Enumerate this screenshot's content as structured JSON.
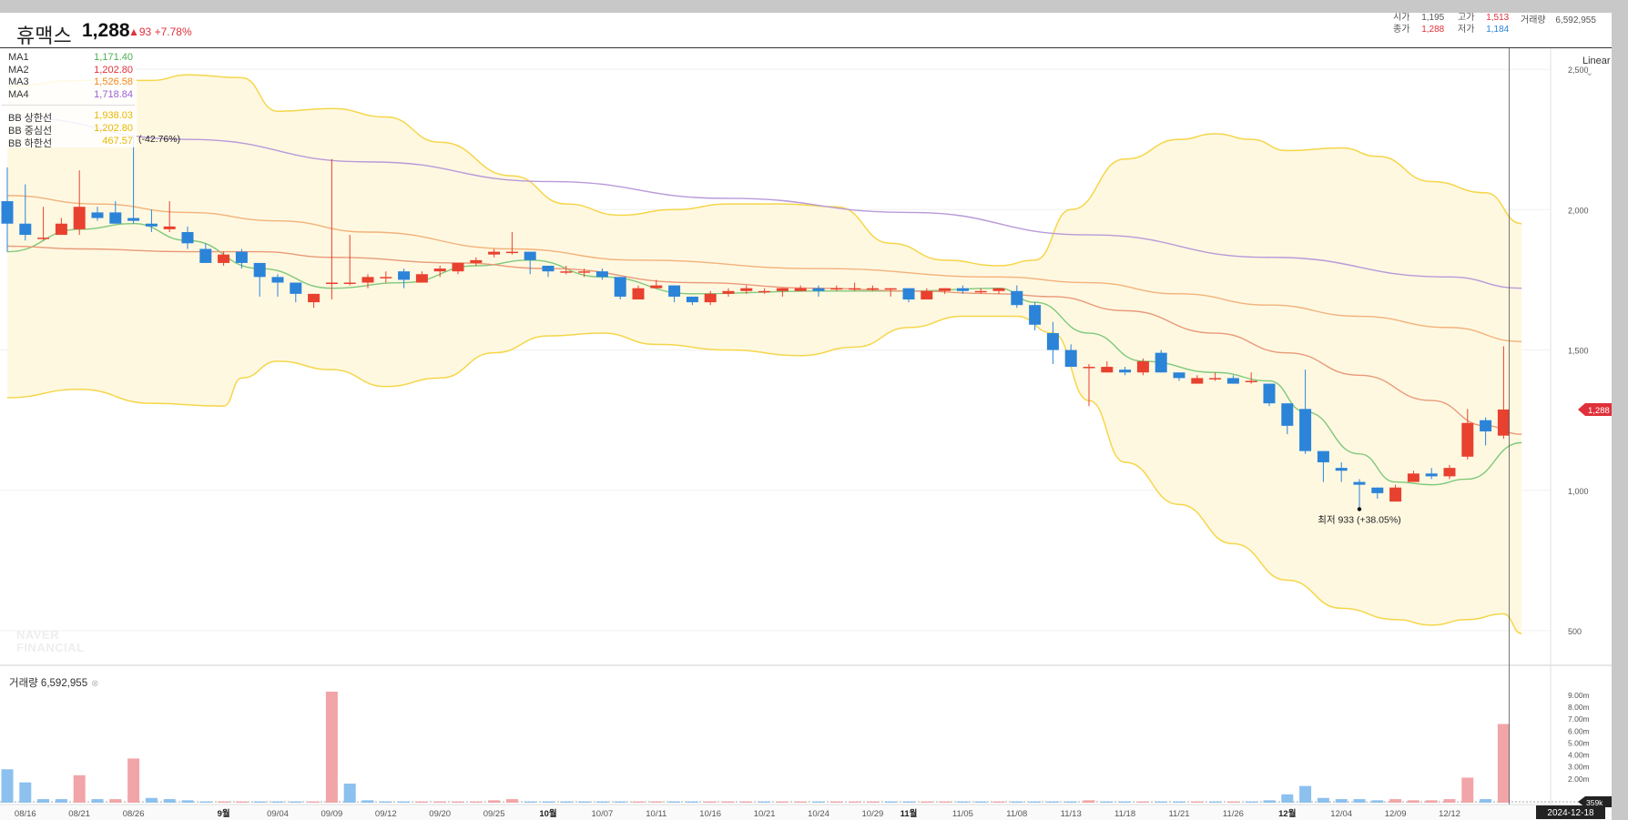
{
  "header": {
    "stock_name": "휴맥스",
    "price": "1,288",
    "change": "▲93",
    "change_pct": "+7.78%",
    "open_label": "시가",
    "open_value": "1,195",
    "high_label": "고가",
    "high_value": "1,513",
    "close_label": "종가",
    "close_value": "1,288",
    "low_label": "저가",
    "low_value": "1,184",
    "volume_label": "거래량",
    "volume_value": "6,592,955"
  },
  "legend": {
    "ma": [
      {
        "name": "MA1",
        "value": "1,171.40",
        "color": "#4caf50"
      },
      {
        "name": "MA2",
        "value": "1,202.80",
        "color": "#e0303a"
      },
      {
        "name": "MA3",
        "value": "1,526.58",
        "color": "#f08a24"
      },
      {
        "name": "MA4",
        "value": "1,718.84",
        "color": "#9c5fd1"
      }
    ],
    "bb": [
      {
        "name": "BB 상한선",
        "value": "1,938.03",
        "color": "#e8b800"
      },
      {
        "name": "BB 중심선",
        "value": "1,202.80",
        "color": "#e8b800"
      },
      {
        "name": "BB 하한선",
        "value": "467.57",
        "color": "#e8b800"
      }
    ]
  },
  "scale_mode": "Linear",
  "volume_title": "거래량 6,592,955",
  "watermark": [
    "NAVER",
    "FINANCIAL"
  ],
  "annotations": {
    "high_note": "(-42.76%)",
    "low_note": "최저 933 (+38.05%)",
    "current_price_tag": "1,288",
    "current_volume_tag": "359k",
    "current_date_tag": "2024-12-18"
  },
  "colors": {
    "up": "#e8412f",
    "down": "#2b84d8",
    "bb_fill": "#fff8e1",
    "bb_line": "#f5d64a",
    "vol_up": "#f1a5a8",
    "vol_down": "#8cc0ee"
  },
  "chart_data": {
    "type": "candlestick",
    "price_axis": {
      "ticks": [
        500,
        1000,
        1500,
        2000,
        2500
      ],
      "tick_labels": [
        "500",
        "1,000",
        "1,500",
        "2,000",
        "2,500"
      ],
      "scale": "linear"
    },
    "volume_axis": {
      "ticks": [
        2,
        3,
        4,
        5,
        6,
        7,
        8,
        9
      ],
      "tick_labels": [
        "2.00m",
        "3.00m",
        "4.00m",
        "5.00m",
        "6.00m",
        "7.00m",
        "8.00m",
        "9.00m"
      ],
      "unit": "millions"
    },
    "x_labels": [
      "08/16",
      "08/21",
      "08/26",
      "9월",
      "09/04",
      "09/09",
      "09/12",
      "09/20",
      "09/25",
      "10월",
      "10/07",
      "10/11",
      "10/16",
      "10/21",
      "10/24",
      "10/29",
      "11월",
      "11/05",
      "11/08",
      "11/13",
      "11/18",
      "11/21",
      "11/26",
      "12월",
      "12/04",
      "12/09",
      "12/12",
      "2024-12-18"
    ],
    "label_slots": [
      1,
      4,
      7,
      12,
      15,
      18,
      21,
      24,
      27,
      30,
      33,
      36,
      39,
      42,
      45,
      48,
      50,
      53,
      56,
      59,
      62,
      65,
      68,
      71,
      74,
      77,
      80,
      84
    ],
    "candles": [
      [
        2030,
        1950,
        2150,
        1850
      ],
      [
        1950,
        1910,
        2090,
        1890
      ],
      [
        1900,
        1900,
        2010,
        1890
      ],
      [
        1910,
        1950,
        1970,
        1910
      ],
      [
        1930,
        2010,
        2140,
        1910
      ],
      [
        1990,
        1970,
        2010,
        1960
      ],
      [
        1990,
        1950,
        2030,
        1950
      ],
      [
        1970,
        1960,
        2260,
        1950
      ],
      [
        1950,
        1940,
        2000,
        1920
      ],
      [
        1930,
        1940,
        2030,
        1920
      ],
      [
        1920,
        1880,
        1940,
        1860
      ],
      [
        1860,
        1810,
        1880,
        1810
      ],
      [
        1810,
        1840,
        1850,
        1800
      ],
      [
        1850,
        1810,
        1860,
        1790
      ],
      [
        1810,
        1760,
        1810,
        1690
      ],
      [
        1760,
        1740,
        1770,
        1690
      ],
      [
        1740,
        1700,
        1740,
        1670
      ],
      [
        1670,
        1700,
        1700,
        1650
      ],
      [
        1740,
        1740,
        2180,
        1680
      ],
      [
        1740,
        1740,
        1910,
        1730
      ],
      [
        1740,
        1760,
        1770,
        1720
      ],
      [
        1760,
        1760,
        1780,
        1740
      ],
      [
        1780,
        1750,
        1790,
        1720
      ],
      [
        1740,
        1770,
        1780,
        1740
      ],
      [
        1780,
        1790,
        1800,
        1760
      ],
      [
        1780,
        1810,
        1810,
        1770
      ],
      [
        1810,
        1820,
        1830,
        1800
      ],
      [
        1840,
        1850,
        1860,
        1830
      ],
      [
        1850,
        1850,
        1920,
        1840
      ],
      [
        1850,
        1820,
        1850,
        1770
      ],
      [
        1800,
        1780,
        1800,
        1760
      ],
      [
        1780,
        1780,
        1800,
        1770
      ],
      [
        1780,
        1780,
        1790,
        1760
      ],
      [
        1780,
        1760,
        1790,
        1750
      ],
      [
        1760,
        1690,
        1760,
        1680
      ],
      [
        1680,
        1720,
        1730,
        1680
      ],
      [
        1720,
        1730,
        1750,
        1720
      ],
      [
        1730,
        1690,
        1730,
        1670
      ],
      [
        1690,
        1670,
        1690,
        1660
      ],
      [
        1670,
        1700,
        1710,
        1660
      ],
      [
        1700,
        1710,
        1720,
        1690
      ],
      [
        1710,
        1720,
        1730,
        1700
      ],
      [
        1710,
        1710,
        1720,
        1700
      ],
      [
        1710,
        1720,
        1720,
        1690
      ],
      [
        1710,
        1720,
        1730,
        1710
      ],
      [
        1720,
        1710,
        1730,
        1690
      ],
      [
        1720,
        1720,
        1730,
        1710
      ],
      [
        1720,
        1720,
        1740,
        1710
      ],
      [
        1720,
        1720,
        1730,
        1710
      ],
      [
        1720,
        1720,
        1720,
        1690
      ],
      [
        1720,
        1680,
        1720,
        1670
      ],
      [
        1680,
        1710,
        1720,
        1680
      ],
      [
        1710,
        1720,
        1720,
        1700
      ],
      [
        1720,
        1710,
        1730,
        1700
      ],
      [
        1710,
        1710,
        1720,
        1700
      ],
      [
        1710,
        1720,
        1720,
        1700
      ],
      [
        1710,
        1660,
        1730,
        1650
      ],
      [
        1660,
        1590,
        1670,
        1570
      ],
      [
        1560,
        1500,
        1600,
        1450
      ],
      [
        1500,
        1440,
        1520,
        1440
      ],
      [
        1440,
        1440,
        1450,
        1300
      ],
      [
        1420,
        1440,
        1460,
        1420
      ],
      [
        1430,
        1420,
        1440,
        1410
      ],
      [
        1420,
        1460,
        1470,
        1410
      ],
      [
        1490,
        1420,
        1500,
        1420
      ],
      [
        1420,
        1400,
        1420,
        1390
      ],
      [
        1380,
        1400,
        1410,
        1380
      ],
      [
        1400,
        1400,
        1420,
        1390
      ],
      [
        1400,
        1380,
        1410,
        1380
      ],
      [
        1390,
        1390,
        1420,
        1380
      ],
      [
        1380,
        1310,
        1380,
        1300
      ],
      [
        1310,
        1230,
        1310,
        1200
      ],
      [
        1290,
        1140,
        1430,
        1130
      ],
      [
        1140,
        1100,
        1140,
        1030
      ],
      [
        1080,
        1070,
        1100,
        1030
      ],
      [
        1030,
        1020,
        1040,
        933
      ],
      [
        1010,
        990,
        1010,
        970
      ],
      [
        960,
        1010,
        1020,
        960
      ],
      [
        1030,
        1060,
        1070,
        1030
      ],
      [
        1060,
        1050,
        1080,
        1040
      ],
      [
        1050,
        1080,
        1090,
        1040
      ],
      [
        1120,
        1240,
        1290,
        1110
      ],
      [
        1250,
        1210,
        1260,
        1160
      ],
      [
        1195,
        1288,
        1513,
        1184
      ]
    ],
    "volume_m": [
      [
        2.8,
        0
      ],
      [
        1.7,
        0
      ],
      [
        0.3,
        0
      ],
      [
        0.3,
        0
      ],
      [
        2.3,
        1
      ],
      [
        0.3,
        0
      ],
      [
        0.3,
        1
      ],
      [
        3.7,
        1
      ],
      [
        0.4,
        0
      ],
      [
        0.3,
        0
      ],
      [
        0.2,
        0
      ],
      [
        0.1,
        0
      ],
      [
        0.1,
        1
      ],
      [
        0.1,
        1
      ],
      [
        0.1,
        0
      ],
      [
        0.1,
        0
      ],
      [
        0.1,
        0
      ],
      [
        0.1,
        1
      ],
      [
        9.3,
        1
      ],
      [
        1.6,
        0
      ],
      [
        0.2,
        0
      ],
      [
        0.1,
        0
      ],
      [
        0.1,
        0
      ],
      [
        0.1,
        1
      ],
      [
        0.1,
        1
      ],
      [
        0.1,
        1
      ],
      [
        0.1,
        1
      ],
      [
        0.2,
        1
      ],
      [
        0.3,
        1
      ],
      [
        0.1,
        0
      ],
      [
        0.1,
        0
      ],
      [
        0.1,
        0
      ],
      [
        0.1,
        0
      ],
      [
        0.1,
        0
      ],
      [
        0.1,
        0
      ],
      [
        0.1,
        1
      ],
      [
        0.1,
        1
      ],
      [
        0.1,
        0
      ],
      [
        0.1,
        0
      ],
      [
        0.1,
        1
      ],
      [
        0.1,
        1
      ],
      [
        0.1,
        1
      ],
      [
        0.1,
        0
      ],
      [
        0.1,
        1
      ],
      [
        0.1,
        1
      ],
      [
        0.1,
        0
      ],
      [
        0.1,
        1
      ],
      [
        0.1,
        1
      ],
      [
        0.1,
        1
      ],
      [
        0.1,
        0
      ],
      [
        0.1,
        0
      ],
      [
        0.1,
        1
      ],
      [
        0.1,
        1
      ],
      [
        0.1,
        0
      ],
      [
        0.1,
        0
      ],
      [
        0.1,
        1
      ],
      [
        0.1,
        0
      ],
      [
        0.1,
        0
      ],
      [
        0.1,
        0
      ],
      [
        0.1,
        0
      ],
      [
        0.2,
        1
      ],
      [
        0.1,
        0
      ],
      [
        0.1,
        0
      ],
      [
        0.1,
        1
      ],
      [
        0.1,
        0
      ],
      [
        0.1,
        0
      ],
      [
        0.1,
        1
      ],
      [
        0.1,
        0
      ],
      [
        0.1,
        1
      ],
      [
        0.1,
        0
      ],
      [
        0.2,
        0
      ],
      [
        0.7,
        0
      ],
      [
        1.4,
        0
      ],
      [
        0.4,
        0
      ],
      [
        0.3,
        0
      ],
      [
        0.3,
        0
      ],
      [
        0.2,
        0
      ],
      [
        0.3,
        1
      ],
      [
        0.2,
        1
      ],
      [
        0.2,
        1
      ],
      [
        0.3,
        1
      ],
      [
        2.1,
        1
      ],
      [
        0.3,
        0
      ],
      [
        6.59,
        1
      ]
    ],
    "ma": [
      {
        "name": "MA1",
        "color": "#7fc97a",
        "points": [
          [
            0,
            1850
          ],
          [
            4,
            1930
          ],
          [
            7,
            1950
          ],
          [
            10,
            1890
          ],
          [
            14,
            1790
          ],
          [
            18,
            1720
          ],
          [
            22,
            1740
          ],
          [
            26,
            1800
          ],
          [
            29,
            1820
          ],
          [
            33,
            1760
          ],
          [
            38,
            1700
          ],
          [
            45,
            1710
          ],
          [
            50,
            1710
          ],
          [
            55,
            1720
          ],
          [
            57,
            1670
          ],
          [
            60,
            1560
          ],
          [
            63,
            1460
          ],
          [
            67,
            1420
          ],
          [
            70,
            1390
          ],
          [
            72,
            1280
          ],
          [
            75,
            1130
          ],
          [
            77,
            1030
          ],
          [
            79,
            1020
          ],
          [
            81,
            1040
          ],
          [
            84,
            1170
          ]
        ]
      },
      {
        "name": "MA2",
        "color": "#e89a78",
        "points": [
          [
            0,
            1870
          ],
          [
            4,
            1860
          ],
          [
            10,
            1850
          ],
          [
            14,
            1850
          ],
          [
            18,
            1830
          ],
          [
            25,
            1810
          ],
          [
            30,
            1790
          ],
          [
            38,
            1740
          ],
          [
            45,
            1720
          ],
          [
            50,
            1710
          ],
          [
            55,
            1700
          ],
          [
            58,
            1690
          ],
          [
            62,
            1640
          ],
          [
            67,
            1560
          ],
          [
            71,
            1490
          ],
          [
            75,
            1410
          ],
          [
            79,
            1320
          ],
          [
            82,
            1230
          ],
          [
            84,
            1200
          ]
        ]
      },
      {
        "name": "MA3",
        "color": "#f2b27a",
        "points": [
          [
            0,
            2050
          ],
          [
            5,
            2020
          ],
          [
            10,
            1990
          ],
          [
            15,
            1960
          ],
          [
            20,
            1920
          ],
          [
            28,
            1860
          ],
          [
            35,
            1820
          ],
          [
            45,
            1790
          ],
          [
            55,
            1760
          ],
          [
            60,
            1740
          ],
          [
            65,
            1700
          ],
          [
            70,
            1660
          ],
          [
            75,
            1620
          ],
          [
            80,
            1580
          ],
          [
            84,
            1530
          ]
        ]
      },
      {
        "name": "MA4",
        "color": "#b89ad8",
        "points": [
          [
            0,
            2330
          ],
          [
            10,
            2250
          ],
          [
            20,
            2170
          ],
          [
            30,
            2100
          ],
          [
            40,
            2040
          ],
          [
            50,
            1990
          ],
          [
            60,
            1910
          ],
          [
            70,
            1830
          ],
          [
            80,
            1760
          ],
          [
            84,
            1720
          ]
        ]
      }
    ],
    "bollinger_upper": [
      [
        0,
        2440
      ],
      [
        4,
        2460
      ],
      [
        8,
        2460
      ],
      [
        10,
        2480
      ],
      [
        13,
        2470
      ],
      [
        15,
        2350
      ],
      [
        18,
        2360
      ],
      [
        21,
        2330
      ],
      [
        24,
        2240
      ],
      [
        28,
        2120
      ],
      [
        31,
        2020
      ],
      [
        34,
        1980
      ],
      [
        37,
        2000
      ],
      [
        40,
        2020
      ],
      [
        43,
        2020
      ],
      [
        46,
        2010
      ],
      [
        49,
        1880
      ],
      [
        52,
        1820
      ],
      [
        55,
        1800
      ],
      [
        57,
        1820
      ],
      [
        59,
        2000
      ],
      [
        62,
        2180
      ],
      [
        65,
        2250
      ],
      [
        67,
        2270
      ],
      [
        69,
        2250
      ],
      [
        71,
        2210
      ],
      [
        74,
        2220
      ],
      [
        76,
        2190
      ],
      [
        79,
        2100
      ],
      [
        82,
        2060
      ],
      [
        84,
        1950
      ]
    ],
    "bollinger_lower": [
      [
        0,
        1330
      ],
      [
        4,
        1360
      ],
      [
        8,
        1310
      ],
      [
        12,
        1300
      ],
      [
        13,
        1400
      ],
      [
        15,
        1460
      ],
      [
        18,
        1430
      ],
      [
        21,
        1370
      ],
      [
        24,
        1400
      ],
      [
        27,
        1490
      ],
      [
        30,
        1550
      ],
      [
        33,
        1560
      ],
      [
        36,
        1520
      ],
      [
        40,
        1500
      ],
      [
        44,
        1480
      ],
      [
        47,
        1510
      ],
      [
        50,
        1580
      ],
      [
        53,
        1620
      ],
      [
        56,
        1620
      ],
      [
        58,
        1560
      ],
      [
        60,
        1320
      ],
      [
        62,
        1100
      ],
      [
        65,
        950
      ],
      [
        68,
        810
      ],
      [
        71,
        680
      ],
      [
        74,
        580
      ],
      [
        77,
        540
      ],
      [
        79,
        520
      ],
      [
        81,
        540
      ],
      [
        83,
        560
      ],
      [
        84,
        490
      ]
    ],
    "price_ylim": [
      377,
      2578
    ],
    "volume_ylim": [
      0,
      9.6
    ]
  }
}
